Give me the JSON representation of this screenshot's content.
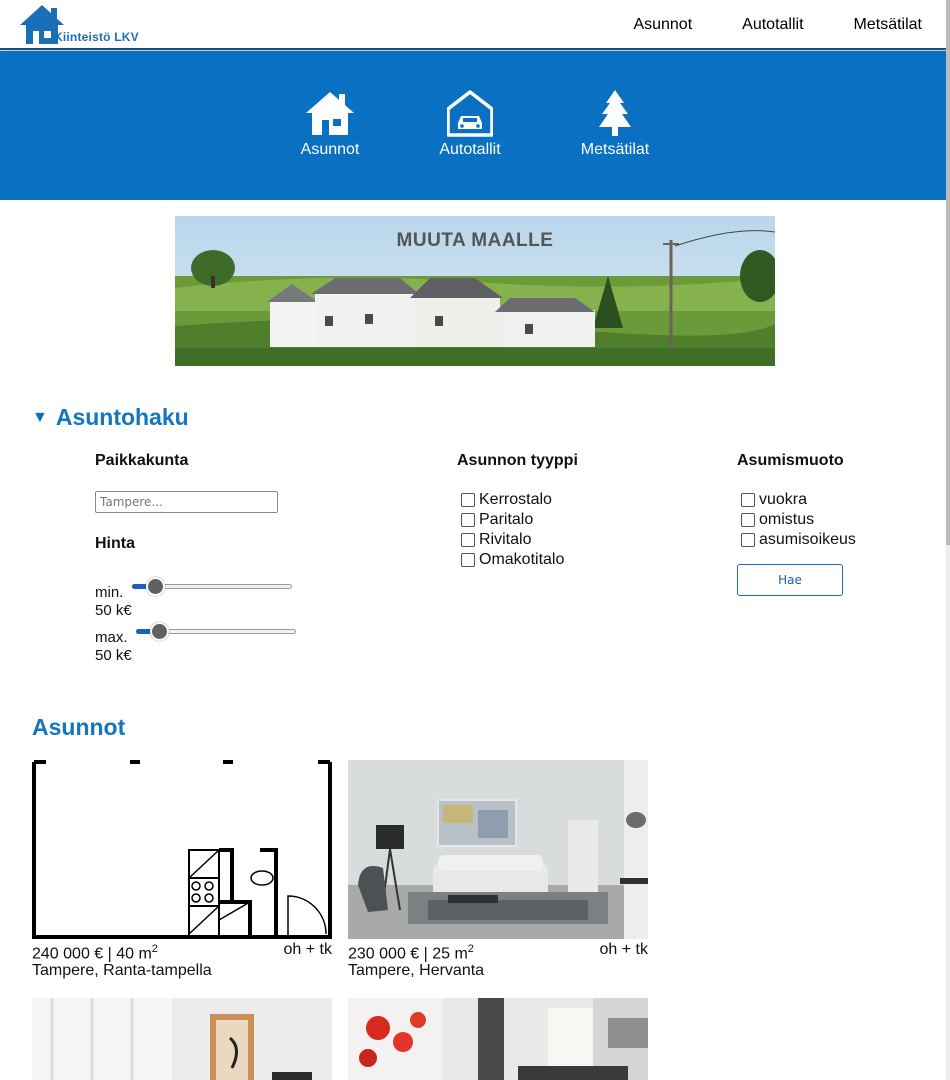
{
  "brand": {
    "name": "Kiinteistö LKV",
    "color": "#1b6fb8"
  },
  "nav": {
    "items": [
      "Asunnot",
      "Autotallit",
      "Metsätilat"
    ]
  },
  "hero": {
    "color": "#0a70c2",
    "items": [
      {
        "label": "Asunnot",
        "icon": "house-icon"
      },
      {
        "label": "Autotallit",
        "icon": "garage-icon"
      },
      {
        "label": "Metsätilat",
        "icon": "tree-icon"
      }
    ]
  },
  "banner": {
    "title": "MUUTA MAALLE"
  },
  "search": {
    "title": "Asuntohaku",
    "location": {
      "label": "Paikkakunta",
      "placeholder": "Tampere..."
    },
    "price": {
      "label": "Hinta",
      "min": {
        "label": "min.",
        "value_text": "50 k€",
        "fraction": 0.1
      },
      "max": {
        "label": "max.",
        "value_text": "50 k€",
        "fraction": 0.1
      }
    },
    "type": {
      "label": "Asunnon tyyppi",
      "options": [
        "Kerrostalo",
        "Paritalo",
        "Rivitalo",
        "Omakotitalo"
      ]
    },
    "tenure": {
      "label": "Asumismuoto",
      "options": [
        "vuokra",
        "omistus",
        "asumisoikeus"
      ]
    },
    "submit_label": "Hae"
  },
  "listings": {
    "title": "Asunnot",
    "items": [
      {
        "price": "240 000 € | 40 m",
        "sup": "2",
        "rooms": "oh + tk",
        "location": "Tampere, Ranta-tampella"
      },
      {
        "price": "230 000 € | 25 m",
        "sup": "2",
        "rooms": "oh + tk",
        "location": "Tampere, Hervanta"
      }
    ]
  }
}
